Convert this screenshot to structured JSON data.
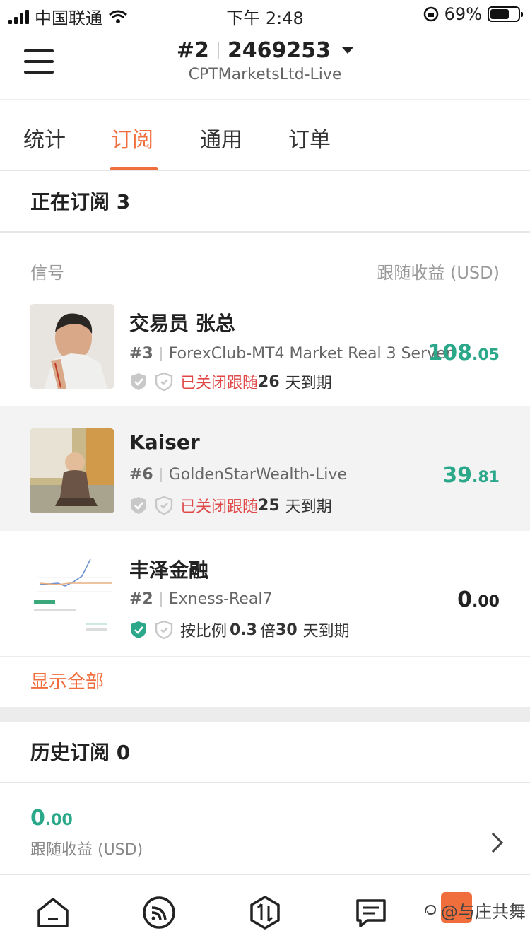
{
  "status_bar": {
    "carrier": "中国联通",
    "time": "下午 2:48",
    "battery_percent": "69%"
  },
  "header": {
    "account_index": "#2",
    "account_number": "2469253",
    "server": "CPTMarketsLtd-Live"
  },
  "tabs": [
    {
      "label": "统计",
      "active": false
    },
    {
      "label": "订阅",
      "active": true
    },
    {
      "label": "通用",
      "active": false
    },
    {
      "label": "订单",
      "active": false
    }
  ],
  "subscribed": {
    "title": "正在订阅 3",
    "col_signal": "信号",
    "col_profit": "跟随收益 (USD)",
    "items": [
      {
        "name": "交易员 张总",
        "index": "#3",
        "server": "ForexClub-MT4 Market Real 3 Server",
        "status": "已关闭跟随",
        "days_num": "26",
        "days_text": "天到期",
        "profit_int": "108",
        "profit_dec": ".05"
      },
      {
        "name": "Kaiser",
        "index": "#6",
        "server": "GoldenStarWealth-Live",
        "status": "已关闭跟随",
        "days_num": "25",
        "days_text": "天到期",
        "profit_int": "39",
        "profit_dec": ".81"
      },
      {
        "name": "丰泽金融",
        "index": "#2",
        "server": "Exness-Real7",
        "ratio_prefix": "按比例",
        "ratio_value": "0.3",
        "ratio_suffix": "倍",
        "days_num": "30",
        "days_text": "天到期",
        "profit_int": "0",
        "profit_dec": ".00"
      }
    ],
    "show_all": "显示全部"
  },
  "history": {
    "title": "历史订阅 0",
    "value_int": "0",
    "value_dec": ".00",
    "label": "跟随收益 (USD)"
  },
  "watermark": "@与庄共舞",
  "colors": {
    "accent": "#f06e3c",
    "profit_green": "#2aa889",
    "closed_red": "#e04848",
    "shield_active": "#2aa889",
    "shield_inactive": "#c8c8c8"
  },
  "icons": {
    "nav": [
      "home-icon",
      "feed-icon",
      "trade-icon",
      "list-icon"
    ]
  }
}
